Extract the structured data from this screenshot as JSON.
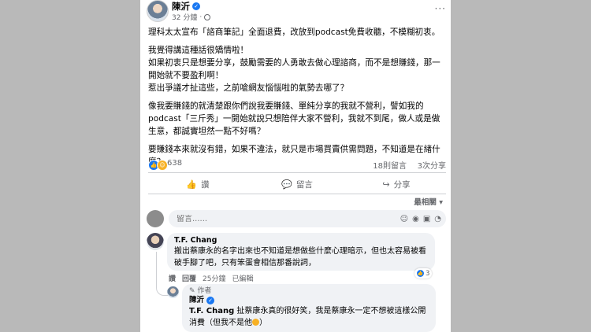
{
  "post": {
    "author": "陳沂",
    "time": "32 分鐘",
    "time_sep": "·",
    "more": "···",
    "paragraphs": [
      "理科太太宣布「諮商筆記」全面退費，改放到podcast免費收聽，不模糊初衷。",
      "我覺得講這種話很矯情啦！\n如果初衷只是想要分享，鼓勵需要的人勇敢去做心理諮商，而不是想賺錢，那一開始就不要盈利啊！\n惹出爭議才扯這些，之前嗆網友惱惱啦的氣勢去哪了？",
      "像我要賺錢的就清楚跟你們說我要賺錢、單純分享的我就不營利，譬如我的podcast「三斤秀」一開始就說只想陪伴大家不營利，我就不到尾，做人或是做生意，都誠實坦然一點不好嗎？",
      "要賺錢本來就沒有錯，如果不違法，就只是市場買賣供需問題，不知道是在緖什麼？"
    ]
  },
  "stats": {
    "reaction_count": "638",
    "comments": "18則留言",
    "shares": "3次分享"
  },
  "actions": {
    "like": "讚",
    "comment": "留言",
    "share": "分享"
  },
  "sort_label": "最相關 ▾",
  "composer": {
    "placeholder": "留言......"
  },
  "comments": [
    {
      "name": "T.F. Chang",
      "text": "搬出蔡康永的名字出來也不知道是想做些什麼心理暗示，但也太容易被看破手腳了吧，只有笨蛋會相信那番說詞，",
      "actions": {
        "like": "讚",
        "reply": "回覆",
        "time": "25分鐘",
        "edited": "已編輯"
      },
      "reaction_count": "3"
    },
    {
      "badge": "✎ 作者",
      "name": "陳沂",
      "mention": "T.F. Chang",
      "text": " 扯蔡康永真的很好笑，我是蔡康永一定不想被這樣公開消費（但我不是他"
    }
  ],
  "icons": {
    "like": "thumbs-up-icon",
    "comment": "speech-bubble-icon",
    "share": "share-arrow-icon"
  },
  "colors": {
    "brand_blue": "#1877f2",
    "secondary_text": "#65676b",
    "bubble_bg": "#f0f2f5"
  }
}
